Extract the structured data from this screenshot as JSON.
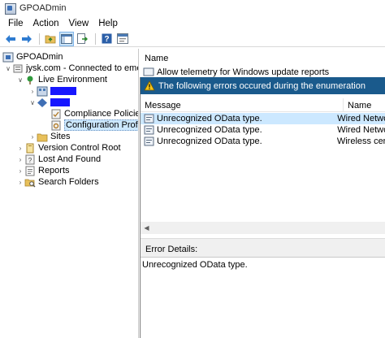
{
  "window": {
    "title": "GPOADmin"
  },
  "menu": {
    "items": [
      "File",
      "Action",
      "View",
      "Help"
    ]
  },
  "toolbar": {
    "buttons": [
      "back-arrow-icon",
      "forward-arrow-icon",
      "folder-up-icon",
      "show-hide-tree-icon",
      "export-icon",
      "help-icon",
      "properties-icon"
    ]
  },
  "tree": {
    "root": "GPOADmin",
    "domain": "jysk.com - Connected to emead",
    "live": "Live Environment",
    "compliance": "Compliance Policies",
    "config": "Configuration Profile",
    "sites": "Sites",
    "vcr": "Version Control Root",
    "lost": "Lost And Found",
    "reports": "Reports",
    "search": "Search Folders"
  },
  "right_pane": {
    "header": "Name",
    "item": "Allow telemetry for Windows update reports"
  },
  "dialog": {
    "title": "The following errors occured during the enumeration",
    "columns": {
      "message": "Message",
      "name": "Name"
    },
    "rows": [
      {
        "message": "Unrecognized OData type.",
        "name": "Wired Netwo"
      },
      {
        "message": "Unrecognized OData type.",
        "name": "Wired Netwo"
      },
      {
        "message": "Unrecognized OData type.",
        "name": "Wireless cert"
      }
    ],
    "details_label": "Error Details:",
    "details_text": "Unrecognized OData type."
  }
}
